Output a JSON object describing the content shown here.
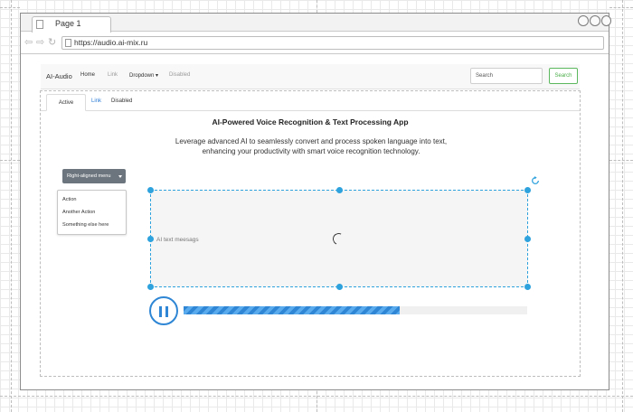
{
  "browser": {
    "tab_title": "Page 1",
    "url": "https://audio.ai-mix.ru",
    "icons": [
      "back-arrow-icon",
      "forward-arrow-icon",
      "reload-icon",
      "page-icon"
    ]
  },
  "navbar": {
    "brand": "AI-Audio",
    "items": [
      {
        "label": "Home"
      },
      {
        "label": "Link"
      },
      {
        "label": "Dropdown"
      },
      {
        "label": "Disabled"
      }
    ],
    "search_placeholder": "Search",
    "search_button": "Search"
  },
  "tabs": [
    {
      "label": "Active"
    },
    {
      "label": "Link"
    },
    {
      "label": "Disabled"
    }
  ],
  "main": {
    "title": "AI-Powered Voice Recognition & Text Processing App",
    "description": "Leverage advanced AI to seamlessly convert and process spoken language into text, enhancing your productivity with smart voice recognition technology."
  },
  "dropdown": {
    "button_label": "Right-aligned menu",
    "items": [
      {
        "label": "Action"
      },
      {
        "label": "Another Action"
      },
      {
        "label": "Something else here"
      }
    ]
  },
  "text_area": {
    "placeholder": "AI text meesags"
  },
  "player": {
    "state": "paused",
    "progress": 0.63
  },
  "colors": {
    "accent": "#2e86d4",
    "selection": "#2ea2dd",
    "success": "#5cb85c",
    "dropdown_button": "#6c757d"
  }
}
